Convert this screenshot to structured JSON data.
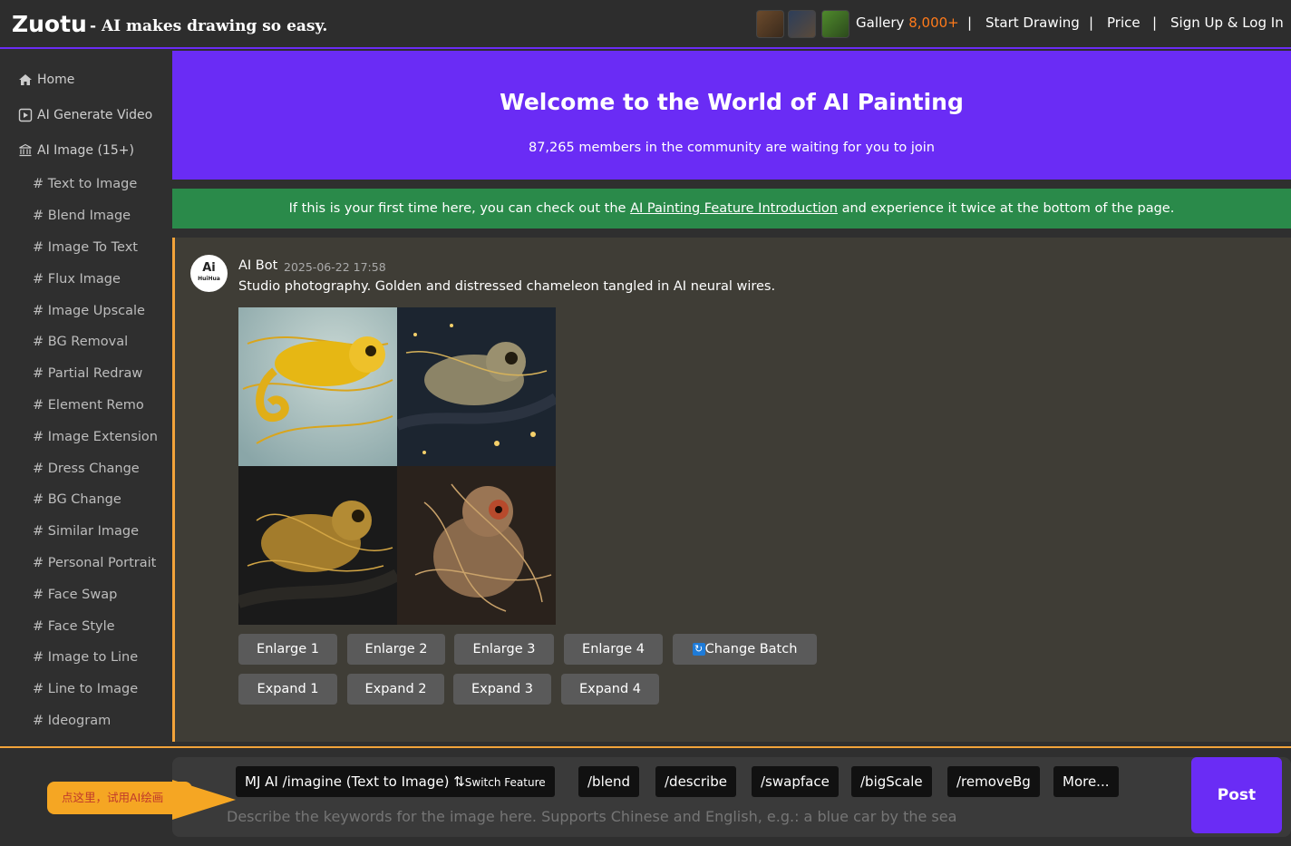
{
  "header": {
    "logo": "Zuotu",
    "tagline": "- AI makes drawing so easy.",
    "nav": {
      "gallery": "Gallery",
      "gallery_count": "8,000+",
      "start": "Start Drawing",
      "price": "Price",
      "signup": "Sign Up & Log In",
      "sep": "|"
    }
  },
  "sidebar": {
    "home": "Home",
    "video": "AI Generate Video",
    "image": "AI Image (15+)",
    "items": [
      "# Text to Image",
      "# Blend Image",
      "# Image To Text",
      "# Flux Image",
      "# Image Upscale",
      "# BG Removal",
      "# Partial Redraw",
      "# Element Remo",
      "# Image Extension",
      "# Dress Change",
      "# BG Change",
      "# Similar Image",
      "# Personal Portrait",
      "# Face Swap",
      "# Face Style",
      "# Image to Line",
      "# Line to Image",
      "# Ideogram"
    ]
  },
  "hero": {
    "title": "Welcome to the World of AI Painting",
    "subtitle": "87,265 members in the community are waiting for you to join"
  },
  "notice": {
    "before": "If this is your first time here, you can check out the ",
    "link": "AI Painting Feature Introduction",
    "after": " and experience it twice at the bottom of the page."
  },
  "post": {
    "avatar_text": "Ai",
    "avatar_sub": "HuiHua",
    "author": "AI Bot",
    "time": "2025-06-22 17:58",
    "text": "Studio photography. Golden and distressed chameleon tangled in AI neural wires.",
    "enlarge": [
      "Enlarge 1",
      "Enlarge 2",
      "Enlarge 3",
      "Enlarge 4"
    ],
    "change_batch": "Change Batch",
    "expand": [
      "Expand 1",
      "Expand 2",
      "Expand 3",
      "Expand 4"
    ]
  },
  "composer": {
    "mode": "MJ AI /imagine (Text to Image)",
    "switch": "Switch Feature",
    "cmds": [
      "/blend",
      "/describe",
      "/swapface",
      "/bigScale",
      "/removeBg",
      "More..."
    ],
    "placeholder": "Describe the keywords for the image here. Supports Chinese and English, e.g.: a blue car by the sea",
    "post": "Post",
    "callout": "点这里，试用AI绘画"
  },
  "colors": {
    "accent": "#6a2cf5",
    "notice": "#2a8a4a",
    "highlight": "#f2a33a",
    "count": "#ff7a1a"
  }
}
